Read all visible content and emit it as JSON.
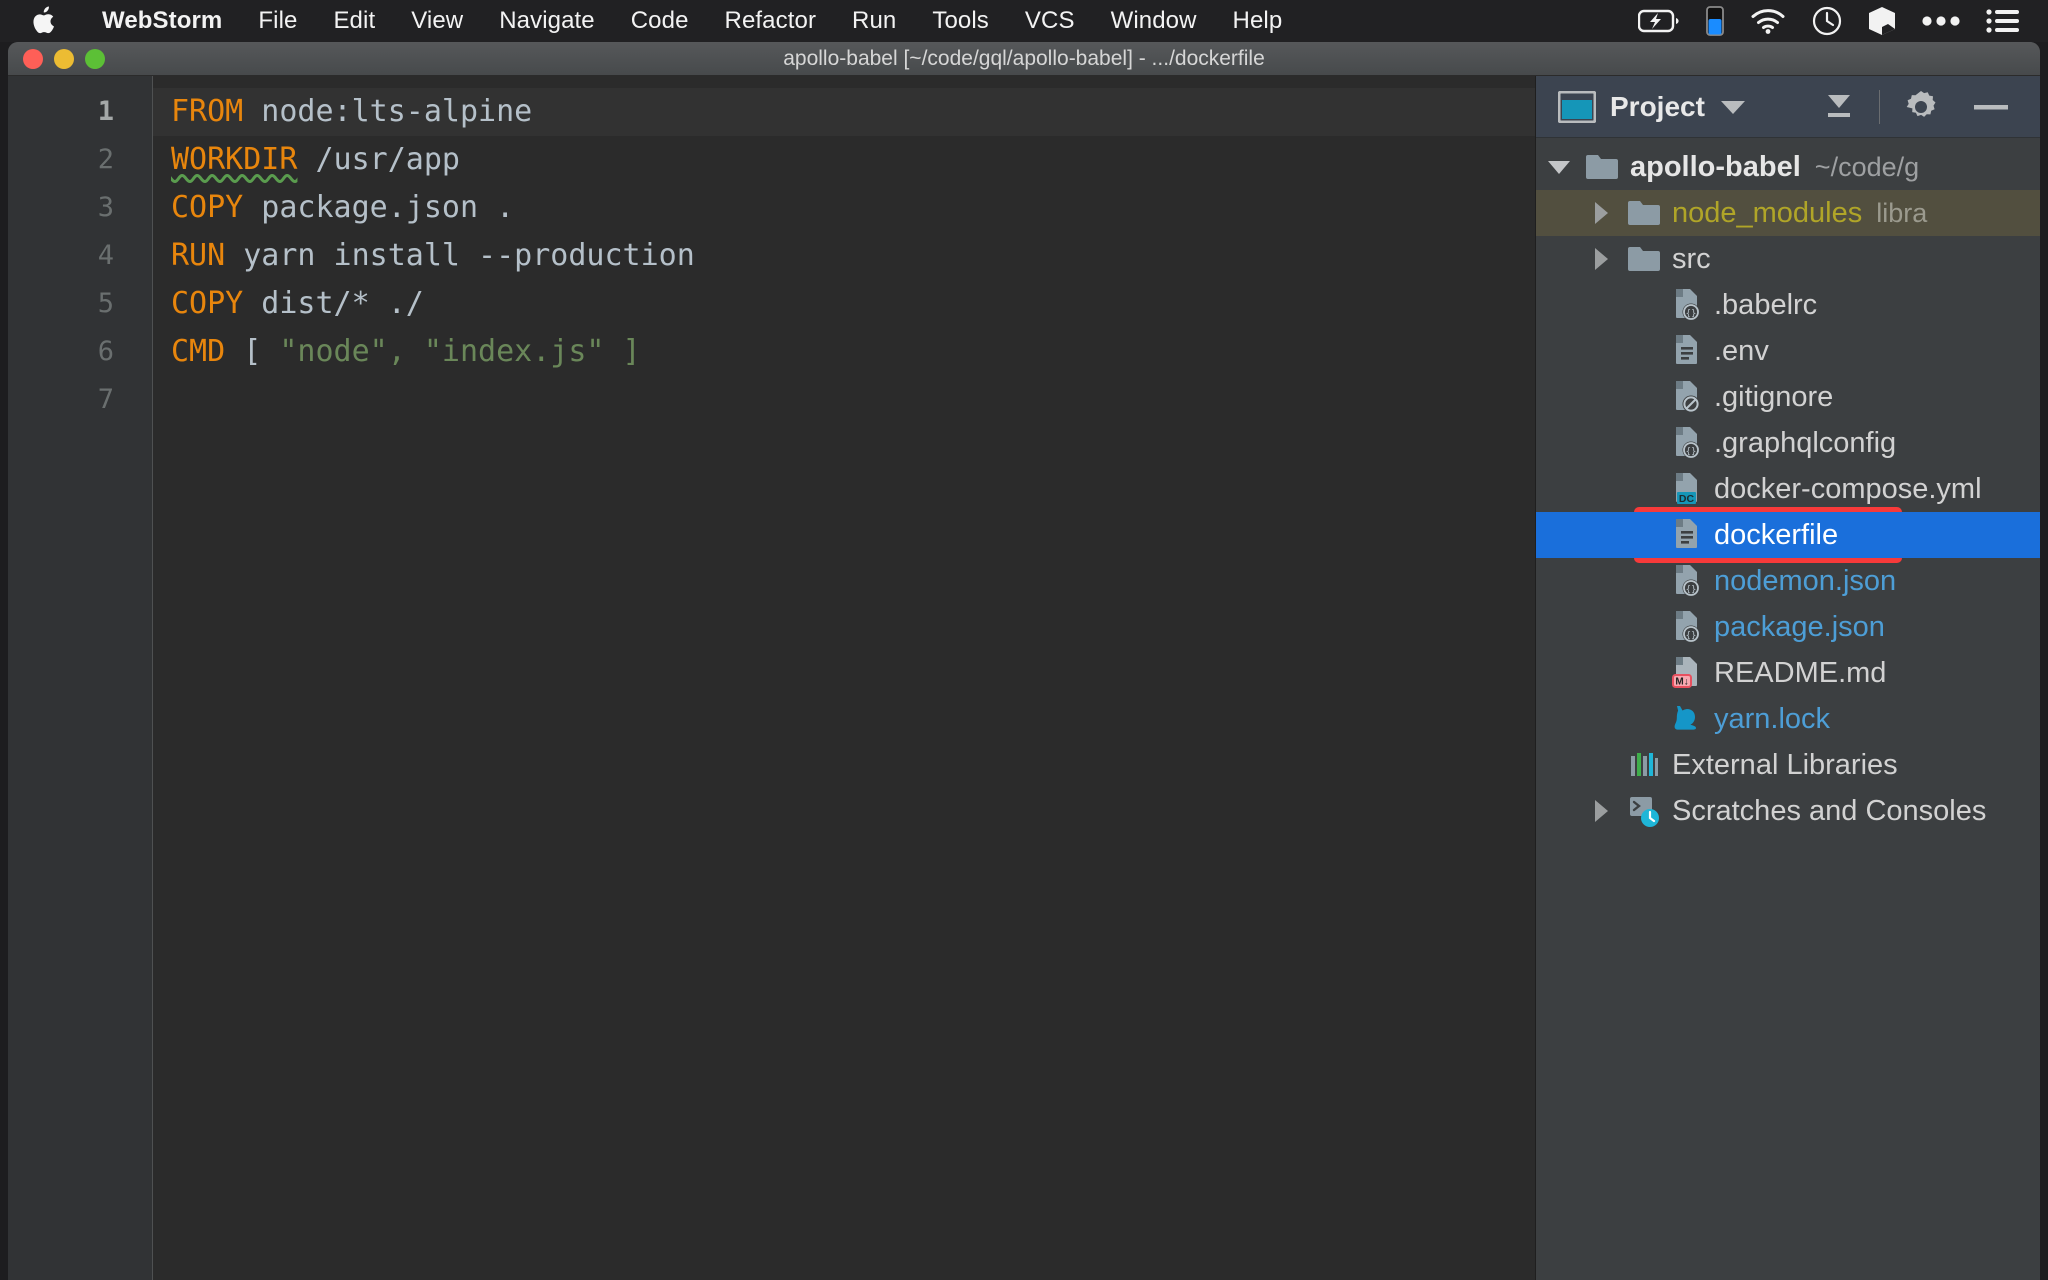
{
  "menubar": {
    "apple_icon": "apple-logo-icon",
    "items": [
      {
        "label": "WebStorm",
        "bold": true
      },
      {
        "label": "File",
        "bold": false
      },
      {
        "label": "Edit",
        "bold": false
      },
      {
        "label": "View",
        "bold": false
      },
      {
        "label": "Navigate",
        "bold": false
      },
      {
        "label": "Code",
        "bold": false
      },
      {
        "label": "Refactor",
        "bold": false
      },
      {
        "label": "Run",
        "bold": false
      },
      {
        "label": "Tools",
        "bold": false
      },
      {
        "label": "VCS",
        "bold": false
      },
      {
        "label": "Window",
        "bold": false
      },
      {
        "label": "Help",
        "bold": false
      }
    ],
    "status_icons": [
      "battery-charging-icon",
      "blue-level-indicator-icon",
      "wifi-icon",
      "clock-icon",
      "cube-icon",
      "ellipsis-icon",
      "control-center-list-icon"
    ],
    "accent_blue": "#1a8cff"
  },
  "window": {
    "title": "apollo-babel [~/code/gql/apollo-babel] - .../dockerfile",
    "traffic_lights": [
      "close-button",
      "minimize-button",
      "zoom-button"
    ],
    "colors": {
      "close": "#ff5f57",
      "minimize": "#ecbc33",
      "zoom": "#5cc036"
    }
  },
  "editor": {
    "inspection_status": "inspections-ok-icon",
    "current_line": 1,
    "line_numbers": [
      "1",
      "2",
      "3",
      "4",
      "5",
      "6",
      "7"
    ],
    "lines": [
      {
        "n": "1",
        "tokens": [
          {
            "t": "FROM",
            "c": "kw"
          },
          {
            "t": " node:lts-alpine",
            "c": "plain"
          }
        ]
      },
      {
        "n": "2",
        "tokens": [
          {
            "t": "WORKDIR",
            "c": "kw squiggle"
          },
          {
            "t": " /usr/app",
            "c": "plain"
          }
        ]
      },
      {
        "n": "3",
        "tokens": [
          {
            "t": "COPY",
            "c": "kw"
          },
          {
            "t": " package.json .",
            "c": "plain"
          }
        ]
      },
      {
        "n": "4",
        "tokens": [
          {
            "t": "RUN",
            "c": "kw"
          },
          {
            "t": " yarn install --production",
            "c": "plain"
          }
        ]
      },
      {
        "n": "5",
        "tokens": [
          {
            "t": "COPY",
            "c": "kw"
          },
          {
            "t": " dist/* ./",
            "c": "plain"
          }
        ]
      },
      {
        "n": "6",
        "tokens": [
          {
            "t": "CMD",
            "c": "kw"
          },
          {
            "t": " ",
            "c": "plain"
          },
          {
            "t": "[",
            "c": "plain"
          },
          {
            "t": " \"node\", \"index.js\" ",
            "c": "str"
          },
          {
            "t": "]",
            "c": "str"
          }
        ]
      },
      {
        "n": "7",
        "tokens": []
      }
    ],
    "colors": {
      "background": "#2b2b2b",
      "current_line_bg": "#323232",
      "gutter_bg": "#313335",
      "keyword": "#e8860d",
      "string": "#6a8759",
      "text": "#b5c0c9",
      "squiggle": "#5a9c4e"
    }
  },
  "project_panel": {
    "icon": "project-window-icon",
    "title": "Project",
    "caret": "chevron-down-icon",
    "buttons": [
      "collapse-all-icon",
      "settings-gear-icon",
      "hide-panel-icon"
    ],
    "header_bg": "#3c4450",
    "selection_bg": "#1a6fdb",
    "excluded_bg": "#524f3f",
    "annotation_color": "#f73a3a",
    "tree": [
      {
        "label": "apollo-babel",
        "sub": "~/code/g",
        "icon": "folder-icon",
        "twisty": "expanded",
        "indent": 0,
        "style": "bold"
      },
      {
        "label": "node_modules",
        "sub": "libra",
        "icon": "folder-icon",
        "twisty": "collapsed",
        "indent": 1,
        "style": "excluded"
      },
      {
        "label": "src",
        "sub": "",
        "icon": "folder-icon",
        "twisty": "collapsed",
        "indent": 1,
        "style": "normal"
      },
      {
        "label": ".babelrc",
        "sub": "",
        "icon": "json-file-icon",
        "twisty": "none",
        "indent": 2,
        "style": "normal"
      },
      {
        "label": ".env",
        "sub": "",
        "icon": "text-file-icon",
        "twisty": "none",
        "indent": 2,
        "style": "normal"
      },
      {
        "label": ".gitignore",
        "sub": "",
        "icon": "ignored-file-icon",
        "twisty": "none",
        "indent": 2,
        "style": "normal"
      },
      {
        "label": ".graphqlconfig",
        "sub": "",
        "icon": "json-file-icon",
        "twisty": "none",
        "indent": 2,
        "style": "normal"
      },
      {
        "label": "docker-compose.yml",
        "sub": "",
        "icon": "docker-compose-file-icon",
        "twisty": "none",
        "indent": 2,
        "style": "normal"
      },
      {
        "label": "dockerfile",
        "sub": "",
        "icon": "dockerfile-icon",
        "twisty": "none",
        "indent": 2,
        "style": "selected"
      },
      {
        "label": "nodemon.json",
        "sub": "",
        "icon": "json-file-icon",
        "twisty": "none",
        "indent": 2,
        "style": "blue"
      },
      {
        "label": "package.json",
        "sub": "",
        "icon": "json-file-icon",
        "twisty": "none",
        "indent": 2,
        "style": "blue"
      },
      {
        "label": "README.md",
        "sub": "",
        "icon": "markdown-file-icon",
        "twisty": "none",
        "indent": 2,
        "style": "normal"
      },
      {
        "label": "yarn.lock",
        "sub": "",
        "icon": "yarn-cat-icon",
        "twisty": "none",
        "indent": 2,
        "style": "blue"
      },
      {
        "label": "External Libraries",
        "sub": "",
        "icon": "libraries-bars-icon",
        "twisty": "none",
        "indent": 1,
        "style": "normal"
      },
      {
        "label": "Scratches and Consoles",
        "sub": "",
        "icon": "scratches-console-icon",
        "twisty": "collapsed",
        "indent": 1,
        "style": "normal"
      }
    ]
  }
}
